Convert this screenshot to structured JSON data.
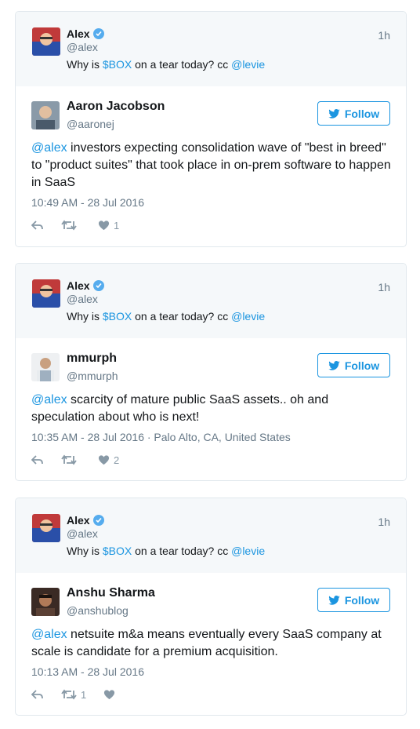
{
  "colors": {
    "link": "#1b95e0",
    "verified": "#55acee",
    "muted": "#657786",
    "icon": "#8899a6",
    "border": "#e1e8ed",
    "quote_bg": "#f5f8fa"
  },
  "icons": {
    "verified": "verified-badge-icon",
    "bird": "twitter-bird-icon",
    "reply": "reply-icon",
    "retweet": "retweet-icon",
    "like": "heart-icon"
  },
  "cards": [
    {
      "quoted": {
        "name": "Alex",
        "handle": "@alex",
        "time": "1h",
        "text_before": "Why is ",
        "cashtag": "$BOX",
        "text_mid": " on a tear today? cc ",
        "mention": "@levie"
      },
      "reply": {
        "name": "Aaron Jacobson",
        "handle": "@aaronej",
        "follow_label": "Follow",
        "mention": "@alex",
        "text": " investors expecting consolidation wave of \"best in breed\" to \"product suites\" that took place in on-prem software to happen in SaaS",
        "meta": "10:49 AM - 28 Jul 2016",
        "retweets": "",
        "likes": "1"
      }
    },
    {
      "quoted": {
        "name": "Alex",
        "handle": "@alex",
        "time": "1h",
        "text_before": "Why is ",
        "cashtag": "$BOX",
        "text_mid": " on a tear today? cc ",
        "mention": "@levie"
      },
      "reply": {
        "name": "mmurph",
        "handle": "@mmurph",
        "follow_label": "Follow",
        "mention": "@alex",
        "text": " scarcity of mature public SaaS assets.. oh and speculation about who is next!",
        "meta": "10:35 AM - 28 Jul 2016 · Palo Alto, CA, United States",
        "retweets": "",
        "likes": "2"
      }
    },
    {
      "quoted": {
        "name": "Alex",
        "handle": "@alex",
        "time": "1h",
        "text_before": "Why is ",
        "cashtag": "$BOX",
        "text_mid": " on a tear today? cc ",
        "mention": "@levie"
      },
      "reply": {
        "name": "Anshu Sharma",
        "handle": "@anshublog",
        "follow_label": "Follow",
        "mention": "@alex",
        "text": " netsuite m&a means eventually every SaaS company at scale is candidate for a premium acquisition.",
        "meta": "10:13 AM - 28 Jul 2016",
        "retweets": "1",
        "likes": ""
      }
    }
  ]
}
